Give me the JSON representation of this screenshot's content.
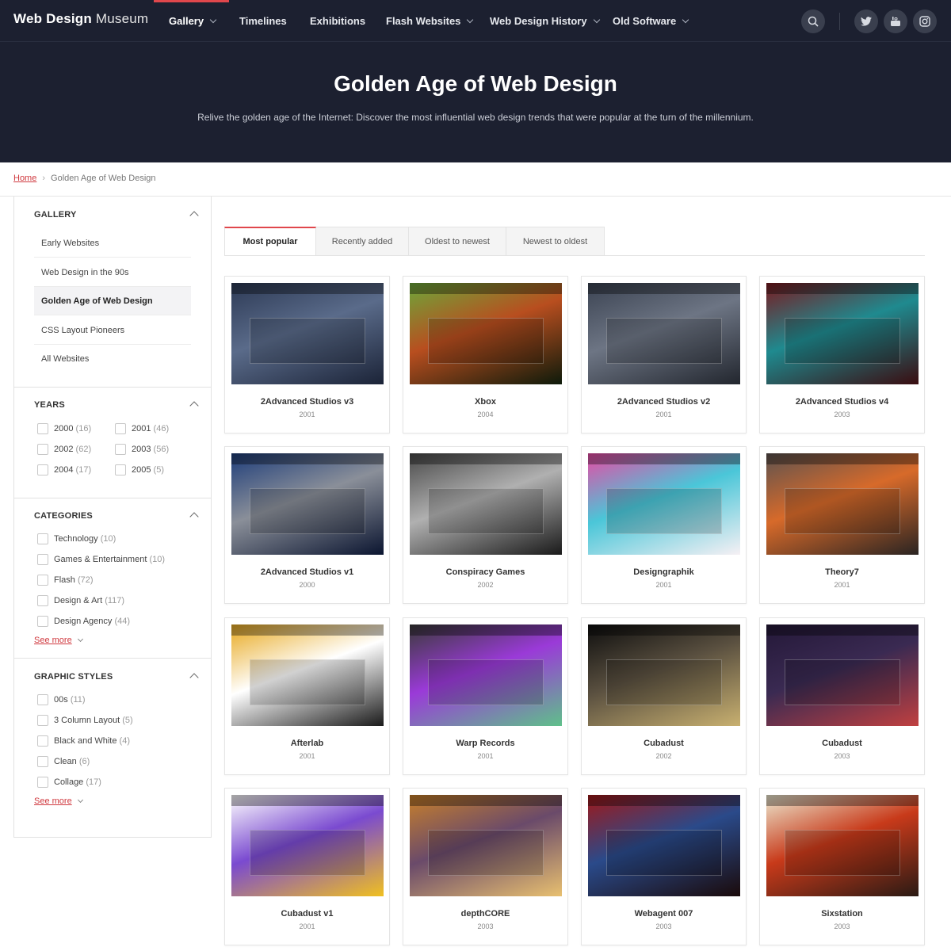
{
  "brand": {
    "bold": "Web Design",
    "light": " Museum"
  },
  "nav": [
    {
      "label": "Gallery",
      "dropdown": true,
      "active": true
    },
    {
      "label": "Timelines",
      "dropdown": false
    },
    {
      "label": "Exhibitions",
      "dropdown": false
    },
    {
      "label": "Flash Websites",
      "dropdown": true
    },
    {
      "label": "Web Design History",
      "dropdown": true
    },
    {
      "label": "Old Software",
      "dropdown": true
    }
  ],
  "nav_icons": [
    "search-icon",
    "twitter-icon",
    "youtube-icon",
    "instagram-icon"
  ],
  "hero": {
    "title": "Golden Age of Web Design",
    "subtitle": "Relive the golden age of the Internet: Discover the most influential web design trends that were popular at the turn of the millennium."
  },
  "breadcrumb": {
    "home": "Home",
    "current": "Golden Age of Web Design"
  },
  "sidebar": {
    "gallery": {
      "title": "GALLERY",
      "links": [
        "Early Websites",
        "Web Design in the 90s",
        "Golden Age of Web Design",
        "CSS Layout Pioneers",
        "All Websites"
      ],
      "active_index": 2
    },
    "years": {
      "title": "YEARS",
      "items": [
        {
          "label": "2000",
          "count": "(16)"
        },
        {
          "label": "2001",
          "count": "(46)"
        },
        {
          "label": "2002",
          "count": "(62)"
        },
        {
          "label": "2003",
          "count": "(56)"
        },
        {
          "label": "2004",
          "count": "(17)"
        },
        {
          "label": "2005",
          "count": "(5)"
        }
      ]
    },
    "categories": {
      "title": "CATEGORIES",
      "items": [
        {
          "label": "Technology",
          "count": "(10)"
        },
        {
          "label": "Games & Entertainment",
          "count": "(10)"
        },
        {
          "label": "Flash",
          "count": "(72)"
        },
        {
          "label": "Design & Art",
          "count": "(117)"
        },
        {
          "label": "Design Agency",
          "count": "(44)"
        }
      ],
      "see_more": "See more"
    },
    "styles": {
      "title": "GRAPHIC STYLES",
      "items": [
        {
          "label": "00s",
          "count": "(11)"
        },
        {
          "label": "3 Column Layout",
          "count": "(5)"
        },
        {
          "label": "Black and White",
          "count": "(4)"
        },
        {
          "label": "Clean",
          "count": "(6)"
        },
        {
          "label": "Collage",
          "count": "(17)"
        }
      ],
      "see_more": "See more"
    }
  },
  "tabs": [
    {
      "label": "Most popular",
      "active": true
    },
    {
      "label": "Recently added"
    },
    {
      "label": "Oldest to newest"
    },
    {
      "label": "Newest to oldest"
    }
  ],
  "cards": [
    {
      "title": "2Advanced Studios v3",
      "year": "2001",
      "palette": [
        "#2d3a55",
        "#5a6b8a",
        "#1b2337"
      ]
    },
    {
      "title": "Xbox",
      "year": "2004",
      "palette": [
        "#6ca83a",
        "#b84e1f",
        "#0d1a0a"
      ]
    },
    {
      "title": "2Advanced Studios v2",
      "year": "2001",
      "palette": [
        "#3b4352",
        "#6d7584",
        "#22262e"
      ]
    },
    {
      "title": "2Advanced Studios v4",
      "year": "2003",
      "palette": [
        "#7a1a20",
        "#1f8a8f",
        "#3a0c10"
      ]
    },
    {
      "title": "2Advanced Studios v1",
      "year": "2000",
      "palette": [
        "#1e3d7a",
        "#8a8f99",
        "#0b1530"
      ]
    },
    {
      "title": "Conspiracy Games",
      "year": "2002",
      "palette": [
        "#4a4a4a",
        "#b0b0b0",
        "#1a1a1a"
      ]
    },
    {
      "title": "Designgraphik",
      "year": "2001",
      "palette": [
        "#e84aa4",
        "#4ac6d8",
        "#f6f0f4"
      ]
    },
    {
      "title": "Theory7",
      "year": "2001",
      "palette": [
        "#5d5350",
        "#d76a2a",
        "#2a2422"
      ]
    },
    {
      "title": "Afterlab",
      "year": "2001",
      "palette": [
        "#e8a920",
        "#ffffff",
        "#1a1a1a"
      ]
    },
    {
      "title": "Warp Records",
      "year": "2001",
      "palette": [
        "#3a3a3a",
        "#9a3ad8",
        "#5fc08a"
      ]
    },
    {
      "title": "Cubadust",
      "year": "2002",
      "palette": [
        "#0e0e0e",
        "#5a5040",
        "#c8b070"
      ]
    },
    {
      "title": "Cubadust",
      "year": "2003",
      "palette": [
        "#241838",
        "#3a2a52",
        "#c04040"
      ]
    },
    {
      "title": "Cubadust v1",
      "year": "2001",
      "palette": [
        "#ffffff",
        "#7a4ad0",
        "#f0c020"
      ]
    },
    {
      "title": "depthCORE",
      "year": "2003",
      "palette": [
        "#c8802a",
        "#6a4a6a",
        "#e8c070"
      ]
    },
    {
      "title": "Webagent 007",
      "year": "2003",
      "palette": [
        "#a01818",
        "#2a4a8a",
        "#1a0a0a"
      ]
    },
    {
      "title": "Sixstation",
      "year": "2003",
      "palette": [
        "#ece8d0",
        "#c83a1a",
        "#2a1a14"
      ]
    }
  ]
}
